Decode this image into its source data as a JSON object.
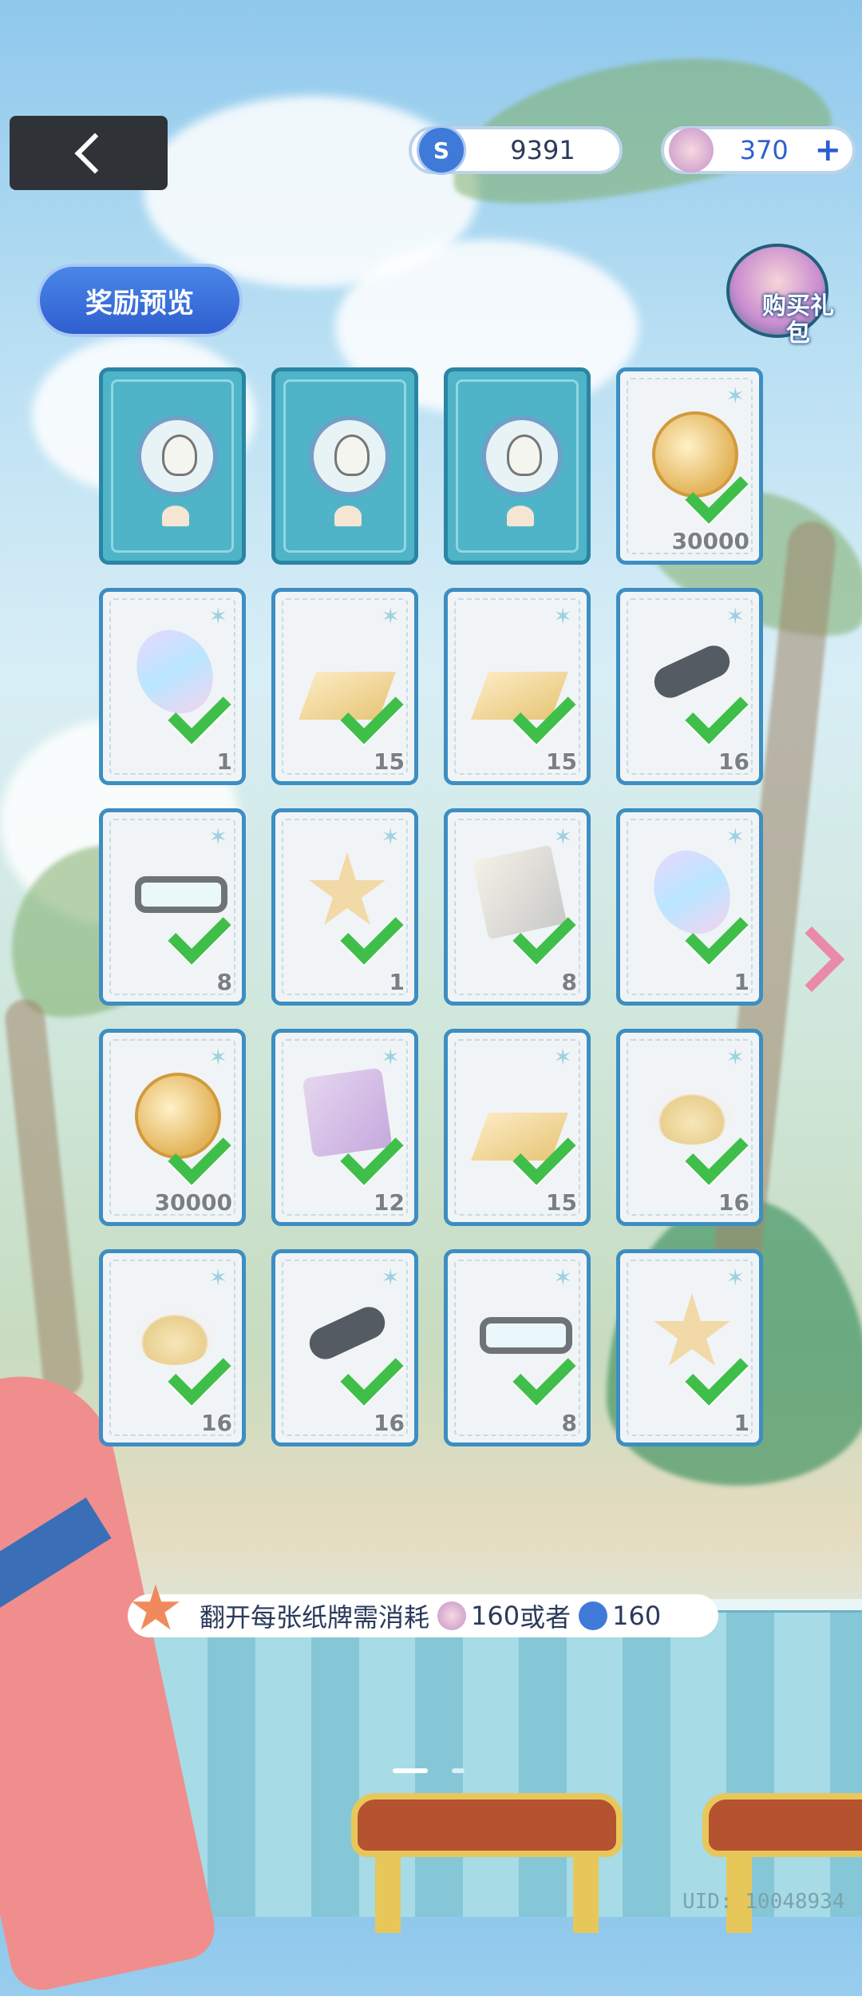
{
  "topbar": {
    "gem_value": "9391",
    "shell_value": "370",
    "plus_label": "+"
  },
  "reward_preview_label": "奖励预览",
  "gift_label": "购买礼包",
  "cards": [
    {
      "state": "back",
      "icon": "seagull-emblem-icon",
      "count": "",
      "collected": false
    },
    {
      "state": "back",
      "icon": "seagull-emblem-icon",
      "count": "",
      "collected": false
    },
    {
      "state": "back",
      "icon": "seagull-emblem-icon",
      "count": "",
      "collected": false
    },
    {
      "state": "front",
      "icon": "gold-coin-icon",
      "count": "30000",
      "collected": true
    },
    {
      "state": "front",
      "icon": "crystal-icon",
      "count": "1",
      "collected": true
    },
    {
      "state": "front",
      "icon": "diamond-plaque-icon",
      "count": "15",
      "collected": true
    },
    {
      "state": "front",
      "icon": "heart-plaque-icon",
      "count": "15",
      "collected": true
    },
    {
      "state": "front",
      "icon": "pocket-knife-icon",
      "count": "16",
      "collected": true
    },
    {
      "state": "front",
      "icon": "glasses-icon",
      "count": "8",
      "collected": true
    },
    {
      "state": "front",
      "icon": "mystery-star-icon",
      "count": "1",
      "collected": true
    },
    {
      "state": "front",
      "icon": "book-icon",
      "count": "8",
      "collected": true
    },
    {
      "state": "front",
      "icon": "crystal-icon",
      "count": "1",
      "collected": true
    },
    {
      "state": "front",
      "icon": "gold-coin-icon",
      "count": "30000",
      "collected": true
    },
    {
      "state": "front",
      "icon": "chip-card-icon",
      "count": "12",
      "collected": true
    },
    {
      "state": "front",
      "icon": "triangle-plaque-icon",
      "count": "15",
      "collected": true
    },
    {
      "state": "front",
      "icon": "pearl-bowl-icon",
      "count": "16",
      "collected": true
    },
    {
      "state": "front",
      "icon": "pearl-bowl-icon",
      "count": "16",
      "collected": true
    },
    {
      "state": "front",
      "icon": "pocket-knife-icon",
      "count": "16",
      "collected": true
    },
    {
      "state": "front",
      "icon": "glasses-icon",
      "count": "8",
      "collected": true
    },
    {
      "state": "front",
      "icon": "mystery-star-icon",
      "count": "1",
      "collected": true
    }
  ],
  "cost_bar": {
    "prefix": "翻开每张纸牌需消耗",
    "shell_cost": "160",
    "or_text": "或者",
    "gem_cost": "160"
  },
  "uid": "UID: 10048934",
  "colors": {
    "card_border": "#3d8ec2",
    "check": "#3fbf49",
    "accent_blue": "#2e5fcf",
    "next_arrow": "#e88aa8"
  }
}
